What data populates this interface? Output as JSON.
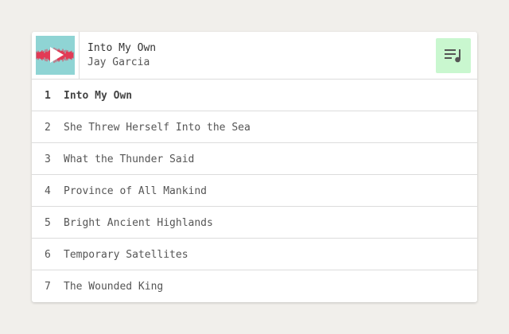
{
  "now_playing": {
    "title": "Into My Own",
    "artist": "Jay Garcia",
    "cover_icon": "waveform-play-icon"
  },
  "playlist_button": {
    "icon": "playlist-icon"
  },
  "tracks": [
    {
      "number": "1",
      "title": "Into My Own",
      "active": true
    },
    {
      "number": "2",
      "title": "She Threw Herself Into the Sea",
      "active": false
    },
    {
      "number": "3",
      "title": "What the Thunder Said",
      "active": false
    },
    {
      "number": "4",
      "title": "Province of All Mankind",
      "active": false
    },
    {
      "number": "5",
      "title": "Bright Ancient Highlands",
      "active": false
    },
    {
      "number": "6",
      "title": "Temporary Satellites",
      "active": false
    },
    {
      "number": "7",
      "title": "The Wounded King",
      "active": false
    }
  ],
  "colors": {
    "background": "#f1efeb",
    "cover": "#8fd4d4",
    "waveform": "#e23a55",
    "playlist_button": "#c9f7cf",
    "text": "#555555"
  }
}
